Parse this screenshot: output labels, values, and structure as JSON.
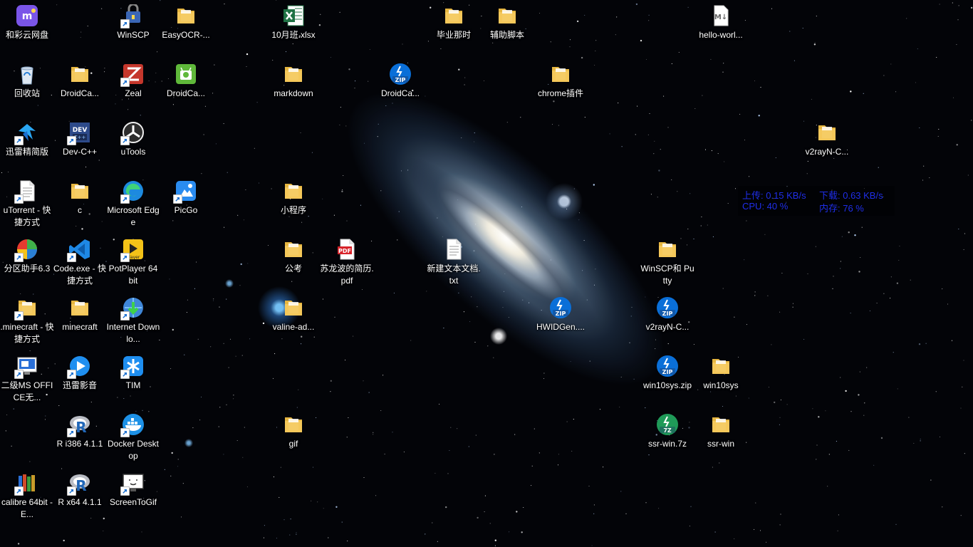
{
  "desktop": {
    "icons": [
      {
        "label": "和彩云网盘",
        "type": "app-mcloud",
        "shortcut": false
      },
      {
        "label": "回收站",
        "type": "recycle-bin",
        "shortcut": false
      },
      {
        "label": "迅雷精简版",
        "type": "app-thunder",
        "shortcut": true
      },
      {
        "label": "uTorrent - 快捷方式",
        "type": "file",
        "shortcut": true
      },
      {
        "label": "分区助手6.3",
        "type": "app-partition",
        "shortcut": true
      },
      {
        "label": ".minecraft - 快捷方式",
        "type": "folder",
        "shortcut": true
      },
      {
        "label": "二级MS OFFICE无...",
        "type": "app-office-exam",
        "shortcut": true
      },
      {
        "label": "calibre 64bit - E...",
        "type": "app-calibre",
        "shortcut": true
      },
      {
        "label": "DroidCa...",
        "type": "folder",
        "shortcut": false
      },
      {
        "label": "Dev-C++",
        "type": "app-devcpp",
        "shortcut": true
      },
      {
        "label": "c",
        "type": "folder",
        "shortcut": false
      },
      {
        "label": "Code.exe - 快捷方式",
        "type": "app-vscode",
        "shortcut": true
      },
      {
        "label": "minecraft",
        "type": "folder",
        "shortcut": false
      },
      {
        "label": "迅雷影音",
        "type": "app-xlplayer",
        "shortcut": true
      },
      {
        "label": "R i386 4.1.1",
        "type": "app-r",
        "shortcut": true
      },
      {
        "label": "R x64 4.1.1",
        "type": "app-r",
        "shortcut": true
      },
      {
        "label": "WinSCP",
        "type": "app-winscp",
        "shortcut": true
      },
      {
        "label": "Zeal",
        "type": "app-zeal",
        "shortcut": true
      },
      {
        "label": "uTools",
        "type": "app-utools",
        "shortcut": true
      },
      {
        "label": "Microsoft Edge",
        "type": "app-edge",
        "shortcut": true
      },
      {
        "label": "PotPlayer 64 bit",
        "type": "app-potplayer",
        "shortcut": true
      },
      {
        "label": "Internet Downlo...",
        "type": "app-idm",
        "shortcut": true
      },
      {
        "label": "TIM",
        "type": "app-tim",
        "shortcut": true
      },
      {
        "label": "Docker Desktop",
        "type": "app-docker",
        "shortcut": true
      },
      {
        "label": "ScreenToGif",
        "type": "app-screentogif",
        "shortcut": true
      },
      {
        "label": "EasyOCR-...",
        "type": "folder",
        "shortcut": false
      },
      {
        "label": "DroidCa...",
        "type": "app-droidcam",
        "shortcut": false
      },
      {
        "label": "PicGo",
        "type": "app-picgo",
        "shortcut": true
      },
      {
        "label": "10月班.xlsx",
        "type": "file-xlsx",
        "shortcut": false
      },
      {
        "label": "markdown",
        "type": "folder",
        "shortcut": false
      },
      {
        "label": "小程序",
        "type": "folder",
        "shortcut": false
      },
      {
        "label": "公考",
        "type": "folder",
        "shortcut": false
      },
      {
        "label": "valine-ad...",
        "type": "folder",
        "shortcut": false
      },
      {
        "label": "gif",
        "type": "folder",
        "shortcut": false
      },
      {
        "label": "苏龙波的简历.pdf",
        "type": "file-pdf",
        "shortcut": false
      },
      {
        "label": "DroidCa...",
        "type": "file-zip",
        "shortcut": false
      },
      {
        "label": "新建文本文档.txt",
        "type": "file-txt",
        "shortcut": false
      },
      {
        "label": "毕业那时",
        "type": "folder",
        "shortcut": false
      },
      {
        "label": "辅助脚本",
        "type": "folder",
        "shortcut": false
      },
      {
        "label": "chrome插件",
        "type": "folder",
        "shortcut": false
      },
      {
        "label": "HWIDGen....",
        "type": "file-zip",
        "shortcut": false
      },
      {
        "label": "WinSCP和 Putty",
        "type": "folder",
        "shortcut": false
      },
      {
        "label": "v2rayN-C...",
        "type": "file-zip",
        "shortcut": false
      },
      {
        "label": "win10sys.zip",
        "type": "file-zip",
        "shortcut": false
      },
      {
        "label": "ssr-win.7z",
        "type": "file-7z",
        "shortcut": false
      },
      {
        "label": "hello-worl...",
        "type": "file-md",
        "shortcut": false
      },
      {
        "label": "win10sys",
        "type": "folder",
        "shortcut": false
      },
      {
        "label": "ssr-win",
        "type": "folder",
        "shortcut": false
      },
      {
        "label": "v2rayN-C...",
        "type": "folder",
        "shortcut": false
      }
    ]
  },
  "netmon": {
    "upload_label": "上传: 0.15 KB/s",
    "download_label": "下载: 0.63 KB/s",
    "cpu_label": "CPU: 40 %",
    "mem_label": "内存: 76 %",
    "text_color": "#1f2ee8"
  },
  "colors": {
    "label_text": "#ffffff",
    "background": "#030408",
    "folder": "#f4c85a",
    "zip_badge": "#0a6fd8",
    "sevenz_badge": "#1f9a58"
  }
}
